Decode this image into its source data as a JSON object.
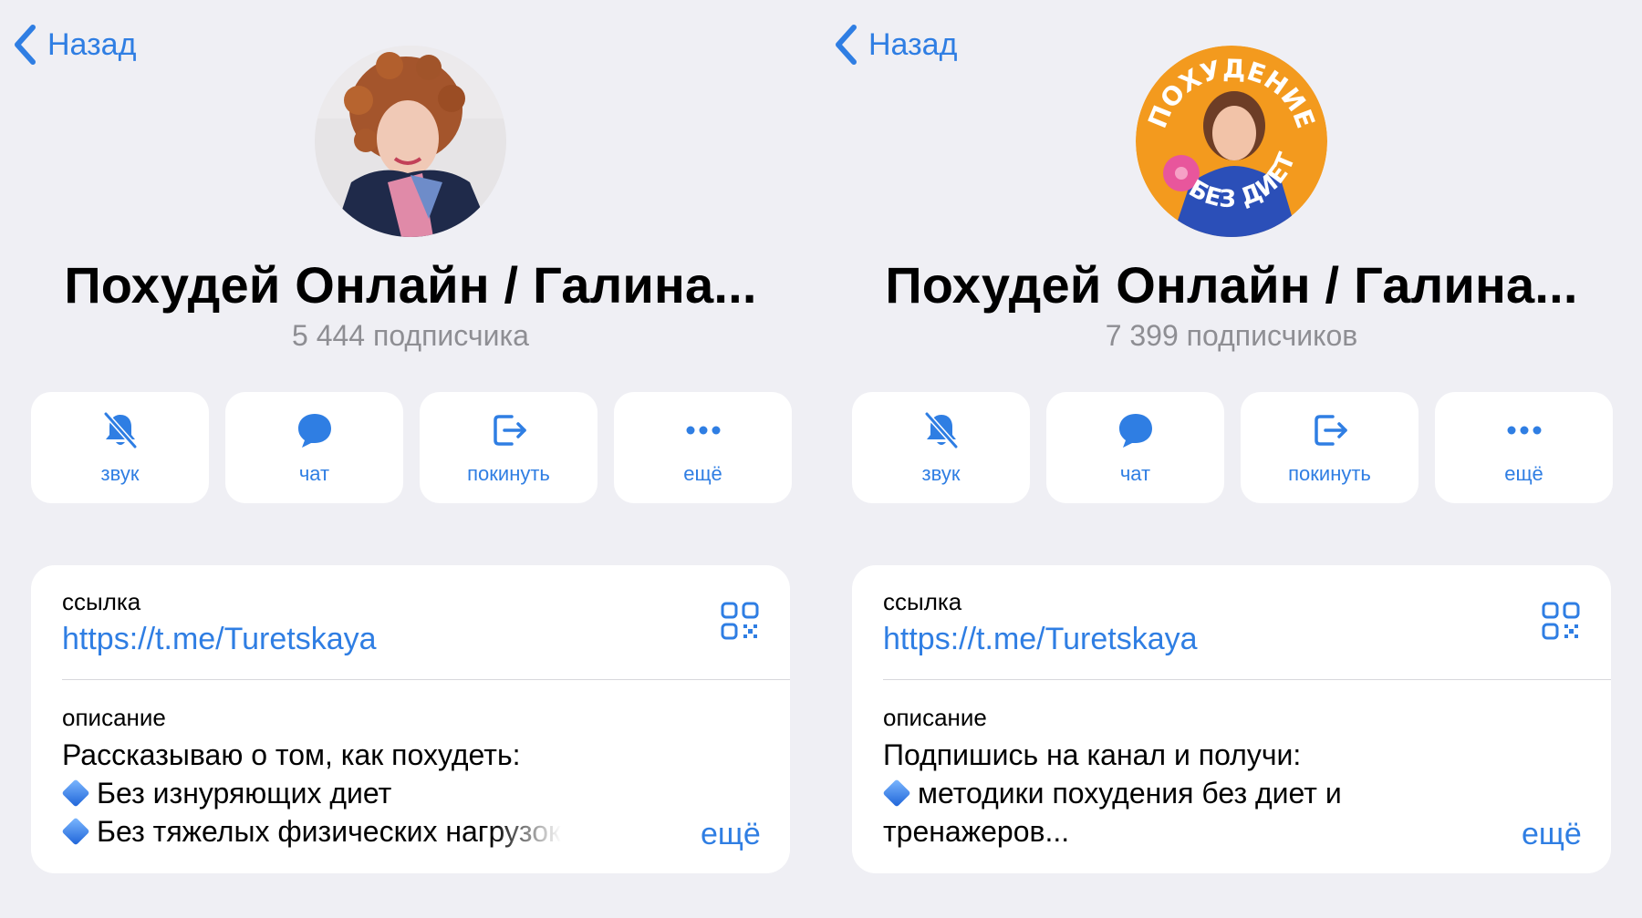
{
  "left": {
    "back_label": "Назад",
    "title": "Похудей Онлайн / Галина...",
    "subscribers": "5 444 подписчика",
    "actions": [
      {
        "label": "звук",
        "icon": "bell-slash-icon"
      },
      {
        "label": "чат",
        "icon": "chat-bubble-icon"
      },
      {
        "label": "покинуть",
        "icon": "leave-icon"
      },
      {
        "label": "ещё",
        "icon": "ellipsis-icon"
      }
    ],
    "link_label": "ссылка",
    "link_url": "https://t.me/Turetskaya",
    "desc_label": "описание",
    "desc_lines": [
      "Рассказываю о том, как похудеть:",
      "Без изнуряющих диет",
      "Без тяжелых физических нагрузок"
    ],
    "more_label": "ещё"
  },
  "right": {
    "back_label": "Назад",
    "title": "Похудей Онлайн / Галина...",
    "subscribers": "7 399 подписчиков",
    "avatar_text_top": "ПОХУДЕНИЕ",
    "avatar_text_bottom": "БЕЗ ДИЕТ",
    "actions": [
      {
        "label": "звук",
        "icon": "bell-slash-icon"
      },
      {
        "label": "чат",
        "icon": "chat-bubble-icon"
      },
      {
        "label": "покинуть",
        "icon": "leave-icon"
      },
      {
        "label": "ещё",
        "icon": "ellipsis-icon"
      }
    ],
    "link_label": "ссылка",
    "link_url": "https://t.me/Turetskaya",
    "desc_label": "описание",
    "desc_lines": [
      "Подпишись на канал и получи:",
      "методики похудения без диет и",
      "тренажеров..."
    ],
    "more_label": "ещё"
  },
  "colors": {
    "accent": "#2f7ee3",
    "background": "#efeff4",
    "card": "#ffffff",
    "secondary_text": "#8e8e93",
    "avatar_orange": "#f39a1e"
  }
}
